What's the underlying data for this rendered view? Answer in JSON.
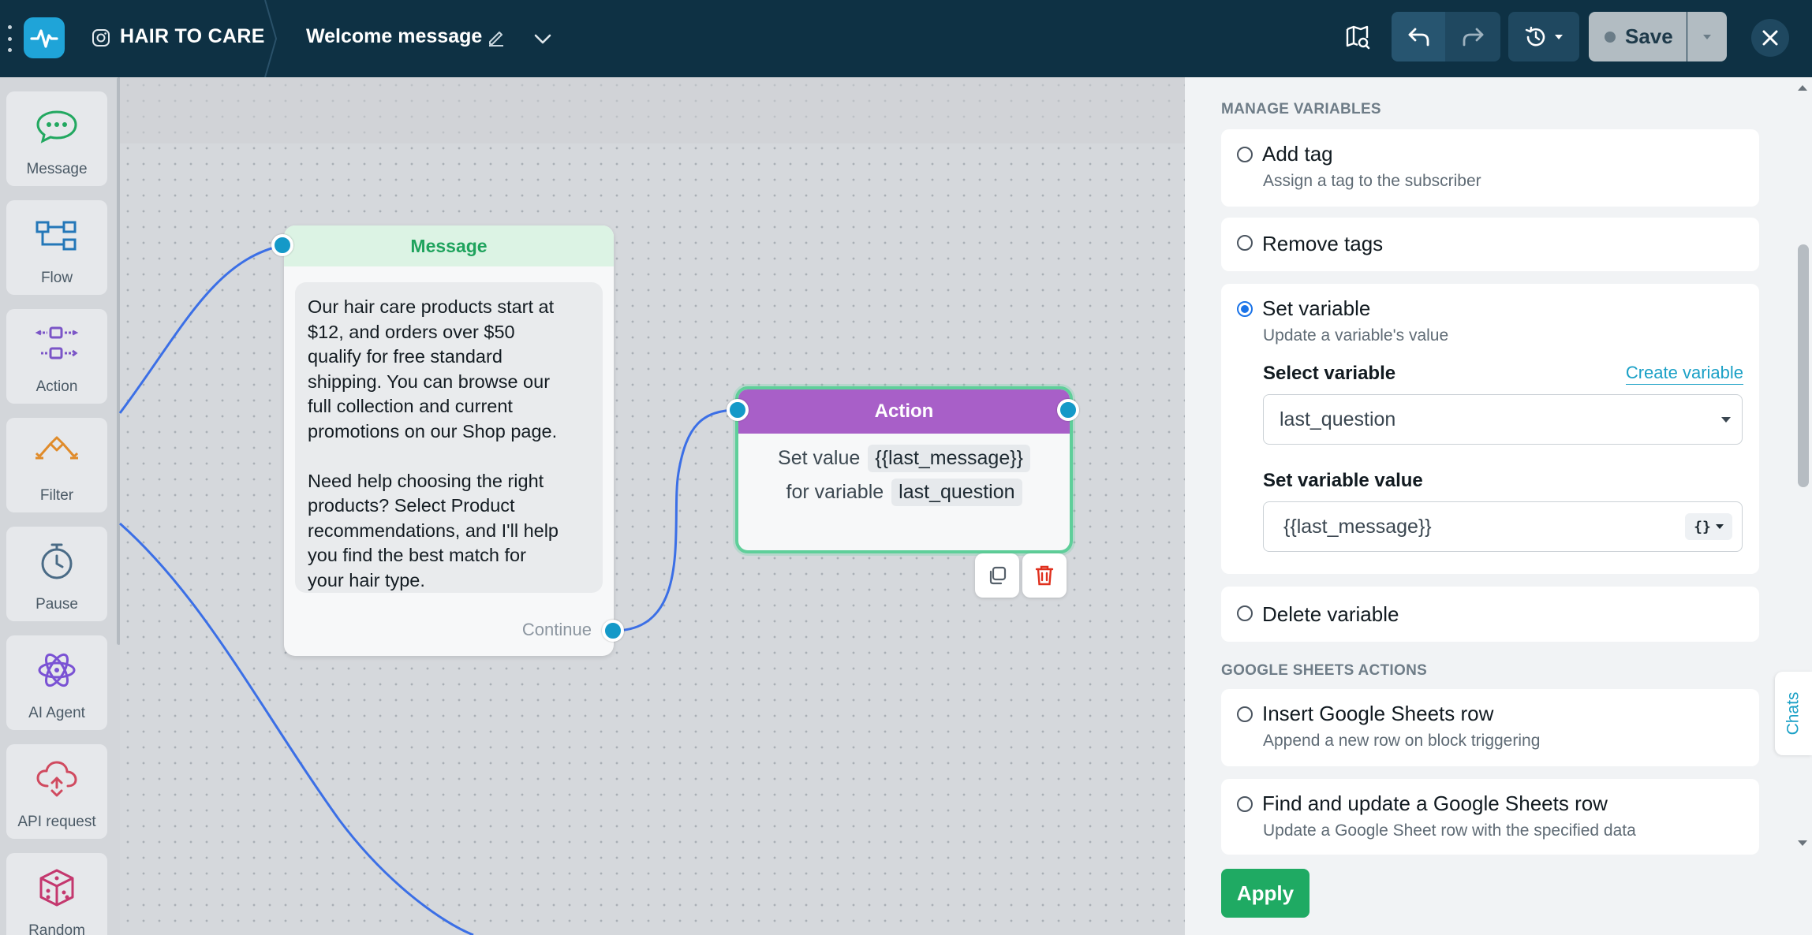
{
  "header": {
    "brand": "HAIR TO CARE",
    "flow_title": "Welcome message",
    "save_label": "Save"
  },
  "toolbox": {
    "items": [
      {
        "label": "Message",
        "icon": "message-bubble-icon"
      },
      {
        "label": "Flow",
        "icon": "flow-icon"
      },
      {
        "label": "Action",
        "icon": "action-icon"
      },
      {
        "label": "Filter",
        "icon": "filter-icon"
      },
      {
        "label": "Pause",
        "icon": "stopwatch-icon"
      },
      {
        "label": "AI Agent",
        "icon": "ai-agent-icon"
      },
      {
        "label": "API request",
        "icon": "api-cloud-icon"
      },
      {
        "label": "Random",
        "icon": "dice-icon"
      }
    ]
  },
  "canvas": {
    "message_node": {
      "title": "Message",
      "text": "Our hair care products start at\n$12, and orders over $50\nqualify for free standard\nshipping. You can browse our\nfull collection and current\npromotions on our Shop page.\n\nNeed help choosing the right\nproducts? Select Product\nrecommendations, and I'll help\nyou find the best match for\nyour hair type.",
      "continue_label": "Continue"
    },
    "action_node": {
      "title": "Action",
      "set_value_label": "Set value",
      "value_pill": "{{last_message}}",
      "for_variable_label": "for variable",
      "variable_pill": "last_question"
    }
  },
  "panel": {
    "manage_variables_heading": "MANAGE VARIABLES",
    "add_tag": {
      "title": "Add tag",
      "desc": "Assign a tag to the subscriber"
    },
    "remove_tags": {
      "title": "Remove tags"
    },
    "set_variable": {
      "title": "Set variable",
      "desc": "Update a variable's value",
      "select_label": "Select variable",
      "create_link": "Create variable",
      "selected_value": "last_question",
      "value_label": "Set variable value",
      "value_input": "{{last_message}}",
      "var_button": "{}"
    },
    "delete_variable": {
      "title": "Delete variable"
    },
    "google_sheets_heading": "GOOGLE SHEETS ACTIONS",
    "insert_row": {
      "title": "Insert Google Sheets row",
      "desc": "Append a new row on block triggering"
    },
    "find_update_row": {
      "title": "Find and update a Google Sheets row",
      "desc": "Update a Google Sheet row with the specified data"
    },
    "apply_label": "Apply",
    "chats_tab": "Chats"
  },
  "colors": {
    "topbar": "#0e3144",
    "message_header": "#1fa35d",
    "action_header": "#a85fc8",
    "port": "#1499c8",
    "wire": "#3b6fe6",
    "apply": "#1faa63",
    "link": "#1aa0c6"
  }
}
